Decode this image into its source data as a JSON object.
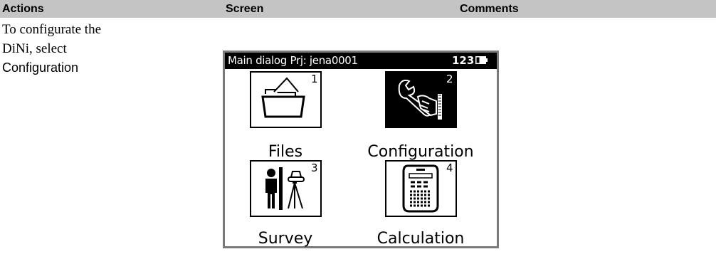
{
  "table": {
    "headers": [
      "Actions",
      "Screen",
      "Comments"
    ],
    "action_lines": [
      "To configurate the",
      "DiNi, select",
      "Configuration"
    ]
  },
  "device": {
    "title": "Main dialog  Prj: jena0001",
    "title_number": "123",
    "tiles": [
      {
        "number": "1",
        "label": "Files",
        "icon": "folder-icon",
        "selected": false
      },
      {
        "number": "2",
        "label": "Configuration",
        "icon": "wrench-hand-icon",
        "selected": true
      },
      {
        "number": "3",
        "label": "Survey",
        "icon": "surveyor-level-icon",
        "selected": false
      },
      {
        "number": "4",
        "label": "Calculation",
        "icon": "calculator-icon",
        "selected": false
      }
    ]
  }
}
